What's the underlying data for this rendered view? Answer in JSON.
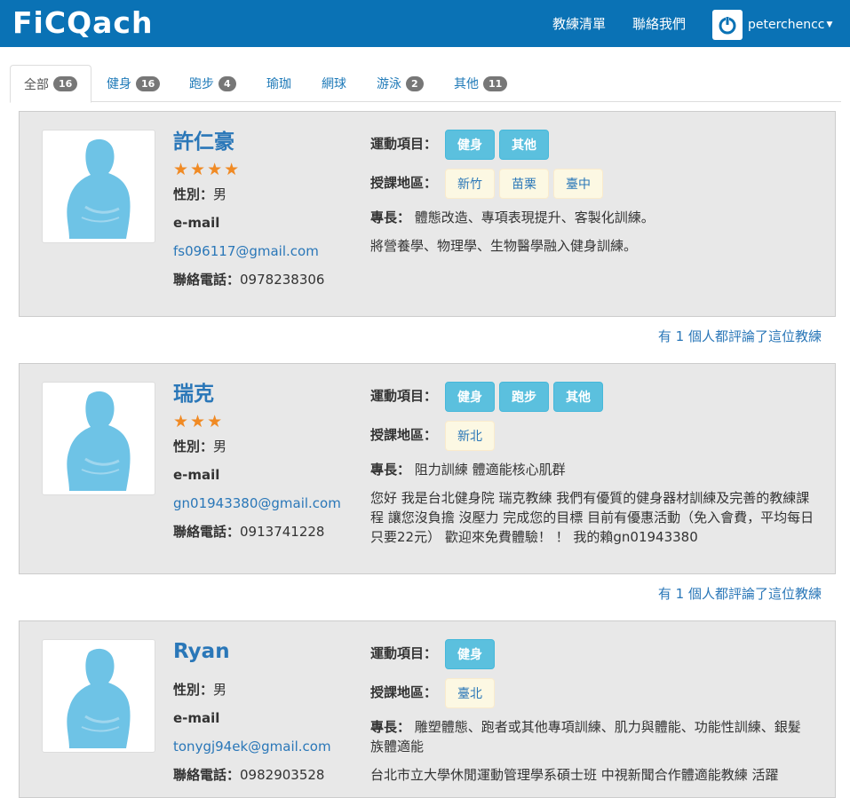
{
  "navbar": {
    "logo": "FiCQach",
    "links": [
      "教練清單",
      "聯絡我們"
    ],
    "username": "peterchencc"
  },
  "tabs": [
    {
      "label": "全部",
      "count": "16"
    },
    {
      "label": "健身",
      "count": "16"
    },
    {
      "label": "跑步",
      "count": "4"
    },
    {
      "label": "瑜珈",
      "count": ""
    },
    {
      "label": "網球",
      "count": ""
    },
    {
      "label": "游泳",
      "count": "2"
    },
    {
      "label": "其他",
      "count": "11"
    }
  ],
  "labels": {
    "sports": "運動項目：",
    "areas": "授課地區：",
    "specialty": "專長：",
    "gender": "性別：",
    "email": "e-mail",
    "phone": "聯絡電話："
  },
  "coaches": [
    {
      "name": "許仁豪",
      "stars": "★★★★",
      "gender": "男",
      "email": "fs096117@gmail.com",
      "phone": "0978238306",
      "sports": [
        "健身",
        "其他"
      ],
      "areas": [
        "新竹",
        "苗栗",
        "臺中"
      ],
      "specialty": "體態改造、專項表現提升、客製化訓練。",
      "description": "將營養學、物理學、生物醫學融入健身訓練。",
      "reviews": "有 1 個人都評論了這位教練"
    },
    {
      "name": "瑞克",
      "stars": "★★★",
      "gender": "男",
      "email": "gn01943380@gmail.com",
      "phone": "0913741228",
      "sports": [
        "健身",
        "跑步",
        "其他"
      ],
      "areas": [
        "新北"
      ],
      "specialty": "阻力訓練 體適能核心肌群",
      "description": "您好 我是台北健身院 瑞克教練 我們有優質的健身器材訓練及完善的教練課程 讓您沒負擔 沒壓力 完成您的目標 目前有優惠活動（免入會費，平均每日只要22元） 歡迎來免費體驗！ ！ 我的賴gn01943380",
      "reviews": "有 1 個人都評論了這位教練"
    },
    {
      "name": "Ryan",
      "stars": "",
      "gender": "男",
      "email": "tonygj94ek@gmail.com",
      "phone": "0982903528",
      "sports": [
        "健身"
      ],
      "areas": [
        "臺北"
      ],
      "specialty": "雕塑體態、跑者或其他專項訓練、肌力與體能、功能性訓練、銀髮族體適能",
      "description": "台北市立大學休閒運動管理學系碩士班 中視新聞合作體適能教練 活躍",
      "reviews": ""
    }
  ],
  "colors": {
    "navbar": "#0a72b5",
    "link": "#2a77b8",
    "sport_chip": "#5bc0de",
    "area_chip": "#fcf8e3",
    "star": "#f08a24",
    "card": "#e8e8e8"
  }
}
